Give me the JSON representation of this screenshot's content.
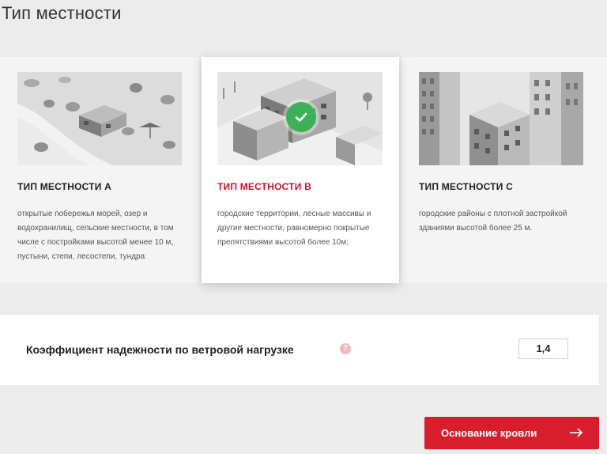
{
  "page": {
    "title": "Тип местности"
  },
  "terrains": [
    {
      "heading": "ТИП МЕСТНОСТИ А",
      "description": "открытые побережья морей, озер и водохранилищ, сельские местности, в том числе с постройками высотой менее 10 м, пустыни, степи, лесостепи, тундра",
      "selected": false,
      "image_icon": "coastal-landscape-illustration"
    },
    {
      "heading": "ТИП МЕСТНОСТИ В",
      "description": "городские территории, лесные массивы и другие местности, равномерно покрытые препятствиями высотой более 10м;",
      "selected": true,
      "image_icon": "city-buildings-illustration"
    },
    {
      "heading": "ТИП МЕСТНОСТИ С",
      "description": "городские районы с плотной застройкой зданиями высотой более 25 м.",
      "selected": false,
      "image_icon": "highrise-buildings-illustration"
    }
  ],
  "coefficient": {
    "label": "Коэффициент надежности по ветровой нагрузке",
    "help_icon": "?",
    "value": "1,4"
  },
  "actions": {
    "next_label": "Основание кровли",
    "next_icon": "arrow-right-icon"
  },
  "colors": {
    "accent": "#d81e2c",
    "selected_heading": "#c8102e",
    "check": "#3cb15a",
    "background": "#ececec"
  }
}
